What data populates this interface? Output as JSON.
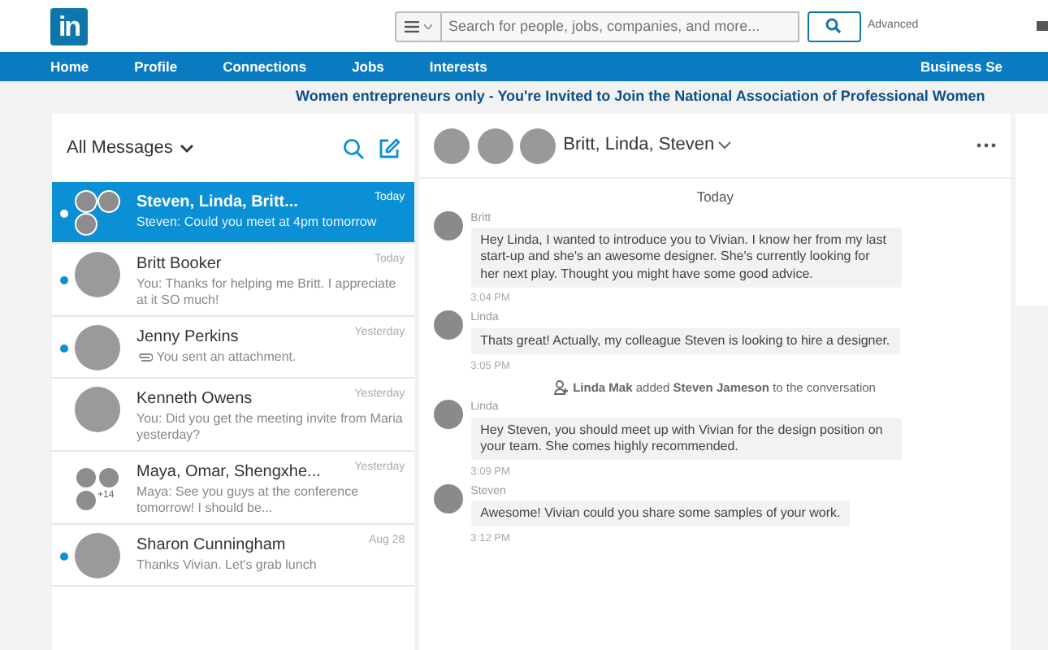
{
  "header": {
    "logo": "in",
    "search": {
      "placeholder": "Search for people, jobs, companies, and more..."
    },
    "advanced": "Advanced"
  },
  "nav": [
    {
      "label": "Home"
    },
    {
      "label": "Profile"
    },
    {
      "label": "Connections"
    },
    {
      "label": "Jobs"
    },
    {
      "label": "Interests"
    },
    {
      "label": "Business Se"
    }
  ],
  "promo": "Women entrepreneurs only - You're Invited to Join the National Association of Professional Women",
  "inbox": {
    "filter": "All Messages",
    "conversations": [
      {
        "name": "Steven, Linda, Britt...",
        "preview": "Steven: Could you meet at 4pm tomorrow",
        "time": "Today",
        "selected": true,
        "unread": true,
        "kind": "group"
      },
      {
        "name": "Britt Booker",
        "preview": "You: Thanks for helping me Britt. I appreciate at it SO much!",
        "time": "Today",
        "selected": false,
        "unread": true,
        "kind": "single"
      },
      {
        "name": "Jenny Perkins",
        "preview": "You sent an attachment.",
        "time": "Yesterday",
        "selected": false,
        "unread": true,
        "kind": "attachment"
      },
      {
        "name": "Kenneth Owens",
        "preview": "You: Did you get the meeting invite from Maria yesterday?",
        "time": "Yesterday",
        "selected": false,
        "unread": false,
        "kind": "single"
      },
      {
        "name": "Maya, Omar, Shengxhe...",
        "preview": "Maya: See you guys at the conference tomorrow! I should be...",
        "time": "Yesterday",
        "selected": false,
        "unread": false,
        "kind": "crowd",
        "extra": "+14"
      },
      {
        "name": "Sharon Cunningham",
        "preview": "Thanks Vivian. Let's grab lunch",
        "time": "Aug 28",
        "selected": false,
        "unread": true,
        "kind": "single"
      }
    ]
  },
  "chat": {
    "title": "Britt, Linda, Steven",
    "day": "Today",
    "items": [
      {
        "kind": "message",
        "sender": "Britt",
        "text": "Hey Linda, I wanted to introduce you to Vivian. I know her from my last start-up and she's an awesome designer. She's currently looking for her next play. Thought you might have some good advice.",
        "time": "3:04 PM"
      },
      {
        "kind": "message",
        "sender": "Linda",
        "text": "Thats great! Actually, my colleague Steven is looking to hire a designer.",
        "time": "3:05 PM"
      },
      {
        "kind": "event",
        "text": "**Linda Mak** added **Steven Jameson** to the conversation"
      },
      {
        "kind": "message",
        "sender": "Linda",
        "text": "Hey Steven, you should meet up with Vivian for the design position on your team. She comes highly recommended.",
        "time": "3:09 PM"
      },
      {
        "kind": "message",
        "sender": "Steven",
        "text": "Awesome! Vivian could you share some samples of your work.",
        "time": "3:12 PM"
      }
    ]
  }
}
